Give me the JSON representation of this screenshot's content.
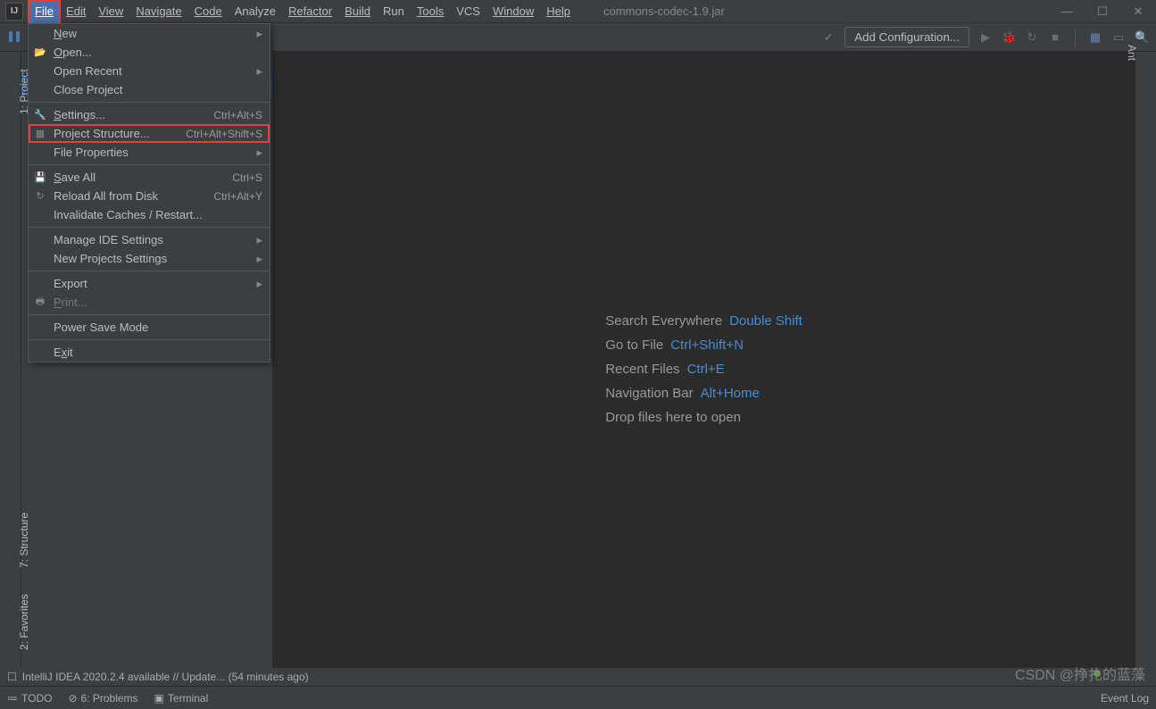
{
  "window": {
    "title": "commons-codec-1.9.jar"
  },
  "menubar": {
    "file": "File",
    "edit": "Edit",
    "view": "View",
    "navigate": "Navigate",
    "code": "Code",
    "analyze": "Analyze",
    "refactor": "Refactor",
    "build": "Build",
    "run": "Run",
    "tools": "Tools",
    "vcs": "VCS",
    "window": "Window",
    "help": "Help"
  },
  "toolbar": {
    "add_config": "Add Configuration..."
  },
  "side": {
    "project": "1: Project",
    "structure": "7: Structure",
    "favorites": "2: Favorites",
    "ant": "Ant"
  },
  "welcome": {
    "r1": {
      "label": "Search Everywhere",
      "key": "Double Shift"
    },
    "r2": {
      "label": "Go to File",
      "key": "Ctrl+Shift+N"
    },
    "r3": {
      "label": "Recent Files",
      "key": "Ctrl+E"
    },
    "r4": {
      "label": "Navigation Bar",
      "key": "Alt+Home"
    },
    "r5": {
      "label": "Drop files here to open"
    }
  },
  "file_menu": [
    {
      "label": "New",
      "submenu": true,
      "underline": "N"
    },
    {
      "label": "Open...",
      "icon": "folder-open-icon",
      "underline": "O"
    },
    {
      "label": "Open Recent",
      "submenu": true
    },
    {
      "label": "Close Project"
    },
    {
      "sep": true
    },
    {
      "label": "Settings...",
      "shortcut": "Ctrl+Alt+S",
      "icon": "wrench-icon",
      "underline": "S"
    },
    {
      "label": "Project Structure...",
      "shortcut": "Ctrl+Alt+Shift+S",
      "icon": "project-structure-icon",
      "highlight": true
    },
    {
      "label": "File Properties",
      "submenu": true
    },
    {
      "sep": true
    },
    {
      "label": "Save All",
      "shortcut": "Ctrl+S",
      "icon": "save-icon",
      "underline": "S"
    },
    {
      "label": "Reload All from Disk",
      "shortcut": "Ctrl+Alt+Y",
      "icon": "reload-icon"
    },
    {
      "label": "Invalidate Caches / Restart..."
    },
    {
      "sep": true
    },
    {
      "label": "Manage IDE Settings",
      "submenu": true
    },
    {
      "label": "New Projects Settings",
      "submenu": true
    },
    {
      "sep": true
    },
    {
      "label": "Export",
      "submenu": true
    },
    {
      "label": "Print...",
      "icon": "print-icon",
      "disabled": true,
      "underline": "P"
    },
    {
      "sep": true
    },
    {
      "label": "Power Save Mode"
    },
    {
      "sep": true
    },
    {
      "label": "Exit",
      "underline": "x"
    }
  ],
  "status": {
    "todo": "TODO",
    "problems": "6: Problems",
    "terminal": "Terminal",
    "event_log": "Event Log",
    "msg": "IntelliJ IDEA 2020.2.4 available // Update... (54 minutes ago)"
  },
  "watermark": "CSDN @挣扎的蓝藻"
}
